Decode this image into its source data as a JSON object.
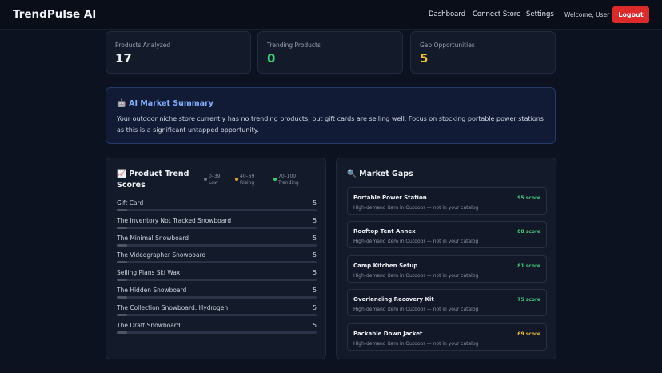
{
  "header": {
    "brand": "TrendPulse AI",
    "nav": [
      {
        "id": "dashboard",
        "label": "Dashboard"
      },
      {
        "id": "connect-store",
        "label": "Connect Store"
      },
      {
        "id": "settings",
        "label": "Settings"
      }
    ],
    "welcome": "Welcome, User",
    "logout_label": "Logout"
  },
  "stats": [
    {
      "label": "Products Analyzed",
      "value": "17",
      "color": "#f2f4f8"
    },
    {
      "label": "Trending Products",
      "value": "0",
      "color": "#3fd17a"
    },
    {
      "label": "Gap Opportunities",
      "value": "5",
      "color": "#f2c230"
    }
  ],
  "summary": {
    "title": "🤖 AI Market Summary",
    "text": "Your outdoor niche store currently has no trending products, but gift cards are selling well. Focus on stocking portable power stations as this is a significant untapped opportunity."
  },
  "trends": {
    "title": "📈 Product Trend Scores",
    "legend": [
      {
        "range": "0–39",
        "label": "Low",
        "color": "#6b7383"
      },
      {
        "range": "40–69",
        "label": "Rising",
        "color": "#e8a33a"
      },
      {
        "range": "70–100",
        "label": "Trending",
        "color": "#3fd17a"
      }
    ],
    "items": [
      {
        "name": "Gift Card",
        "score": 5
      },
      {
        "name": "The Inventory Not Tracked Snowboard",
        "score": 5
      },
      {
        "name": "The Minimal Snowboard",
        "score": 5
      },
      {
        "name": "The Videographer Snowboard",
        "score": 5
      },
      {
        "name": "Selling Plans Ski Wax",
        "score": 5
      },
      {
        "name": "The Hidden Snowboard",
        "score": 5
      },
      {
        "name": "The Collection Snowboard: Hydrogen",
        "score": 5
      },
      {
        "name": "The Draft Snowboard",
        "score": 5
      }
    ]
  },
  "gaps": {
    "title": "🔍 Market Gaps",
    "items": [
      {
        "name": "Portable Power Station",
        "desc": "High-demand item in Outdoor — not in your catalog",
        "score": "95 score",
        "color": "#3fd17a"
      },
      {
        "name": "Rooftop Tent Annex",
        "desc": "High-demand item in Outdoor — not in your catalog",
        "score": "88 score",
        "color": "#3fd17a"
      },
      {
        "name": "Camp Kitchen Setup",
        "desc": "High-demand item in Outdoor — not in your catalog",
        "score": "81 score",
        "color": "#3fd17a"
      },
      {
        "name": "Overlanding Recovery Kit",
        "desc": "High-demand item in Outdoor — not in your catalog",
        "score": "75 score",
        "color": "#3fd17a"
      },
      {
        "name": "Packable Down Jacket",
        "desc": "High-demand item in Outdoor — not in your catalog",
        "score": "69 score",
        "color": "#f2c230"
      }
    ]
  }
}
